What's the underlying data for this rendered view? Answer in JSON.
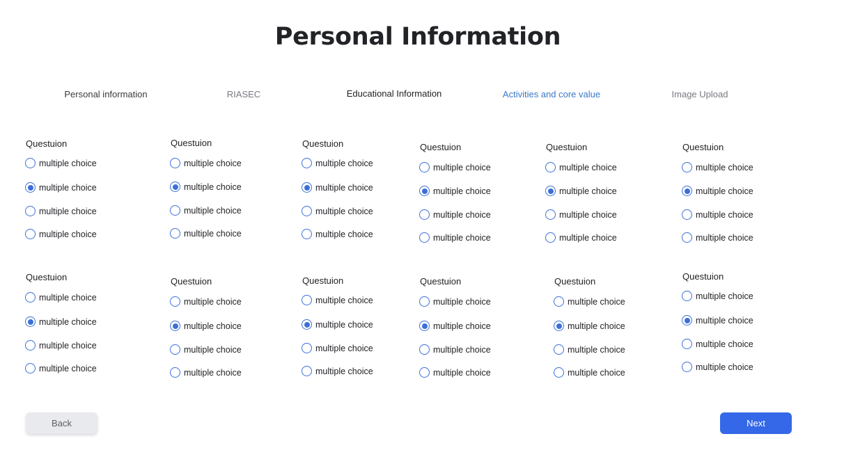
{
  "page": {
    "title": "Personal Information"
  },
  "steps": [
    {
      "label": "Personal information",
      "state": "done"
    },
    {
      "label": "RIASEC",
      "state": "muted"
    },
    {
      "label": "Educational Information",
      "state": "current"
    },
    {
      "label": "Activities and core value",
      "state": "active"
    },
    {
      "label": "Image Upload",
      "state": "muted"
    }
  ],
  "questions": [
    {
      "title": "Questuion",
      "options": [
        "multiple choice",
        "multiple choice",
        "multiple choice",
        "multiple choice"
      ],
      "selected": 1
    },
    {
      "title": "Questuion",
      "options": [
        "multiple choice",
        "multiple choice",
        "multiple choice",
        "multiple choice"
      ],
      "selected": 1
    },
    {
      "title": "Questuion",
      "options": [
        "multiple choice",
        "multiple choice",
        "multiple choice",
        "multiple choice"
      ],
      "selected": 1
    },
    {
      "title": "Questuion",
      "options": [
        "multiple choice",
        "multiple choice",
        "multiple choice",
        "multiple choice"
      ],
      "selected": 1
    },
    {
      "title": "Questuion",
      "options": [
        "multiple choice",
        "multiple choice",
        "multiple choice",
        "multiple choice"
      ],
      "selected": 1
    },
    {
      "title": "Questuion",
      "options": [
        "multiple choice",
        "multiple choice",
        "multiple choice",
        "multiple choice"
      ],
      "selected": 1
    },
    {
      "title": "Questuion",
      "options": [
        "multiple choice",
        "multiple choice",
        "multiple choice",
        "multiple choice"
      ],
      "selected": 1
    },
    {
      "title": "Questuion",
      "options": [
        "multiple choice",
        "multiple choice",
        "multiple choice",
        "multiple choice"
      ],
      "selected": 1
    },
    {
      "title": "Questuion",
      "options": [
        "multiple choice",
        "multiple choice",
        "multiple choice",
        "multiple choice"
      ],
      "selected": 1
    },
    {
      "title": "Questuion",
      "options": [
        "multiple choice",
        "multiple choice",
        "multiple choice",
        "multiple choice"
      ],
      "selected": 1
    },
    {
      "title": "Questuion",
      "options": [
        "multiple choice",
        "multiple choice",
        "multiple choice",
        "multiple choice"
      ],
      "selected": 1
    },
    {
      "title": "Questuion",
      "options": [
        "multiple choice",
        "multiple choice",
        "multiple choice",
        "multiple choice"
      ],
      "selected": 1
    }
  ],
  "footer": {
    "back_label": "Back",
    "next_label": "Next"
  },
  "colors": {
    "accent": "#3468e8",
    "radio": "#3c6fd8",
    "active_step": "#3a78c9"
  }
}
